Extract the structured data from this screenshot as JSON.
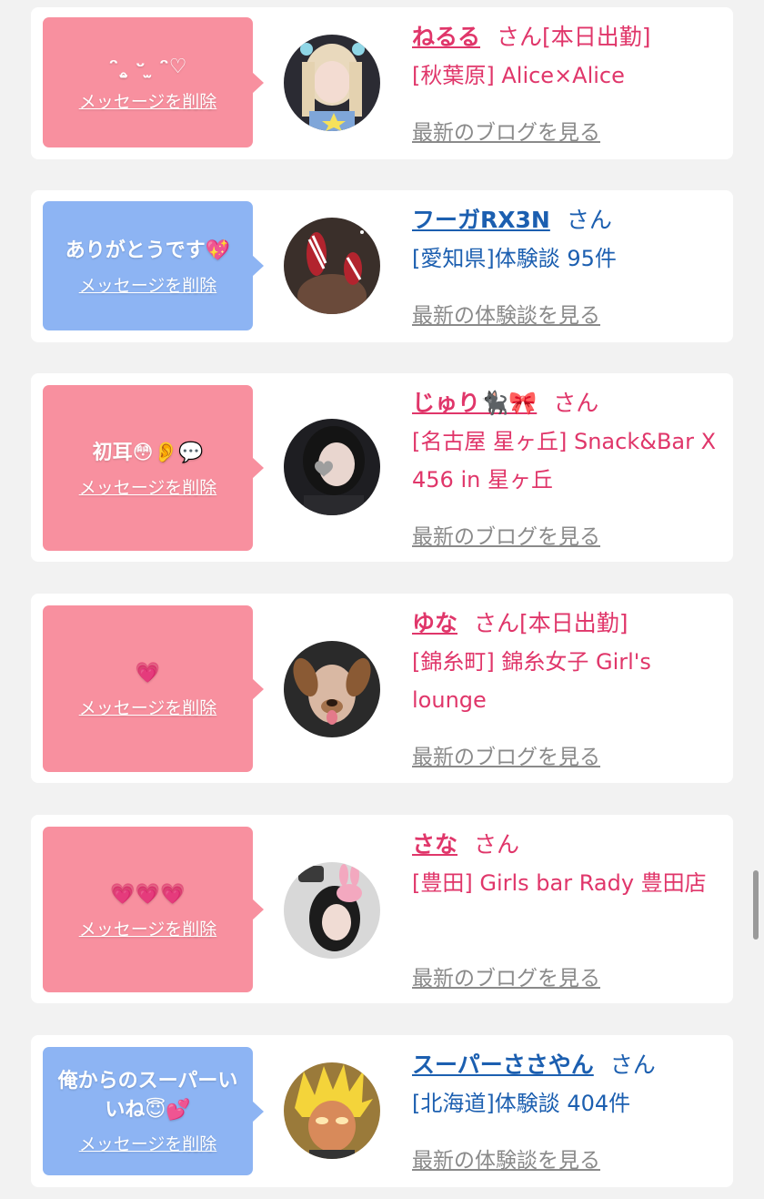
{
  "delete_label": "メッセージを削除",
  "san": "さん",
  "colors": {
    "pink_bubble": "#f8909f",
    "blue_bubble": "#8db4f3",
    "pink_text": "#e0366a",
    "blue_text": "#1c5fb0"
  },
  "cards": [
    {
      "message": "ᵔ˳̫ ᵕ ̫ ᵔ♡",
      "name": "ねるる",
      "suffix": "[本日出勤]",
      "detail": "[秋葉原] Alice×Alice",
      "more": "最新のブログを見る",
      "avatar_icon": "avatar-blonde-girl"
    },
    {
      "message": "ありがとうです💖",
      "name": "フーガRX3N",
      "suffix": "",
      "detail": "[愛知県]体験談 95件",
      "more": "最新の体験談を見る",
      "avatar_icon": "avatar-costume"
    },
    {
      "message": "初耳😳👂💬",
      "name": "じゅり🐈‍⬛🎀",
      "suffix": "",
      "detail": "[名古屋 星ヶ丘] Snack&Bar X 456 in 星ヶ丘",
      "more": "最新のブログを見る",
      "avatar_icon": "avatar-dark-hair-girl"
    },
    {
      "message": "💗",
      "name": "ゆな",
      "suffix": "[本日出勤]",
      "detail": "[錦糸町] 錦糸女子 Girl's lounge",
      "more": "最新のブログを見る",
      "avatar_icon": "avatar-dog-filter"
    },
    {
      "message": "💗💗💗",
      "name": "さな",
      "suffix": "",
      "detail": "[豊田] Girls bar Rady 豊田店",
      "more": "最新のブログを見る",
      "avatar_icon": "avatar-bunny-sticker"
    },
    {
      "message": "俺からのスーパーいいね😇💕",
      "name": "スーパーささやん",
      "suffix": "",
      "detail": "[北海道]体験談 404件",
      "more": "最新の体験談を見る",
      "avatar_icon": "avatar-super-saiyan"
    }
  ]
}
